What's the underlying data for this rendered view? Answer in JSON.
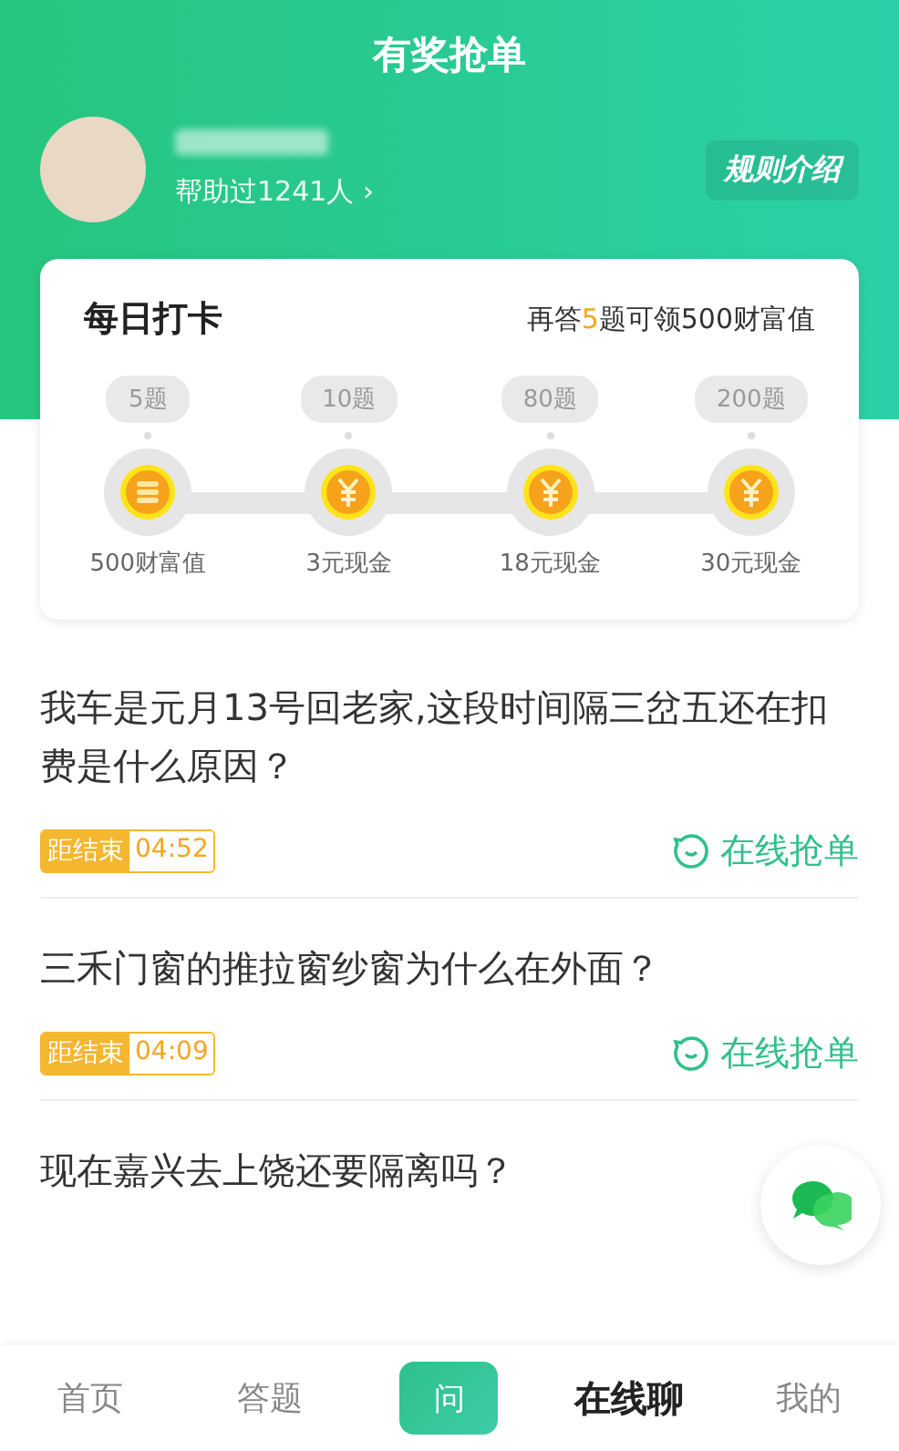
{
  "header": {
    "title": "有奖抢单",
    "helped": "帮助过1241人",
    "helped_arrow": "›",
    "rules_button": "规则介绍"
  },
  "checkin": {
    "title": "每日打卡",
    "progress": {
      "before": "再答",
      "count": "5",
      "after": "题可领500财富值"
    },
    "milestones": [
      {
        "target": "5题",
        "reward": "500财富值",
        "kind": "coins"
      },
      {
        "target": "10题",
        "reward": "3元现金",
        "kind": "cash"
      },
      {
        "target": "80题",
        "reward": "18元现金",
        "kind": "cash"
      },
      {
        "target": "200题",
        "reward": "30元现金",
        "kind": "cash"
      }
    ]
  },
  "questions": [
    {
      "text": "我车是元月13号回老家,这段时间隔三岔五还在扣费是什么原因？",
      "timer_label": "距结束",
      "timer": "04:52",
      "action": "在线抢单"
    },
    {
      "text": "三禾门窗的推拉窗纱窗为什么在外面？",
      "timer_label": "距结束",
      "timer": "04:09",
      "action": "在线抢单"
    },
    {
      "text": "现在嘉兴去上饶还要隔离吗？"
    }
  ],
  "tabbar": [
    {
      "label": "首页",
      "kind": "tab",
      "selected": false
    },
    {
      "label": "答题",
      "kind": "tab",
      "selected": false
    },
    {
      "label": "问",
      "kind": "ask",
      "selected": false
    },
    {
      "label": "在线聊",
      "kind": "tab",
      "selected": true
    },
    {
      "label": "我的",
      "kind": "tab",
      "selected": false
    }
  ]
}
